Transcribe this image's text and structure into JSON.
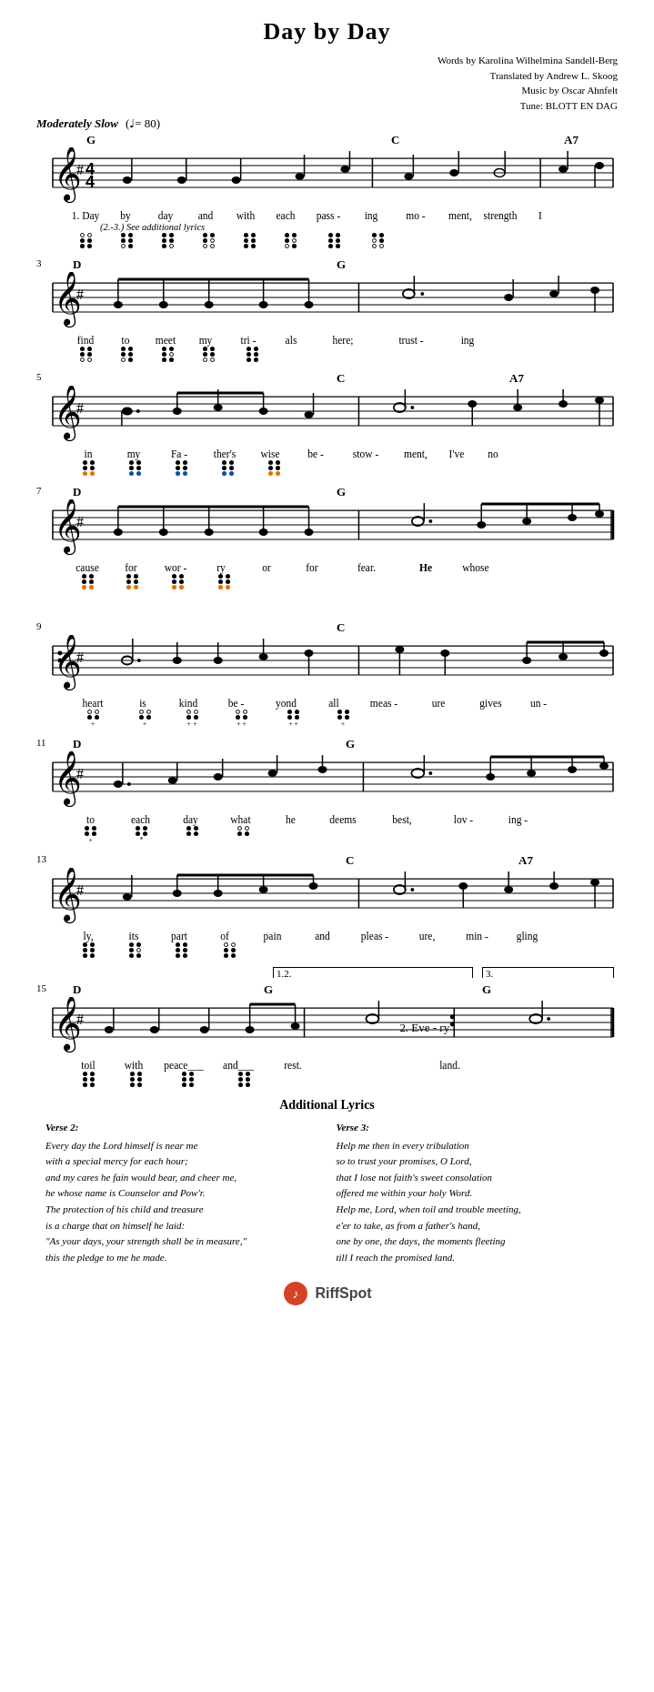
{
  "title": "Day by Day",
  "attribution": {
    "line1": "Words by Karolina Wilhelmina Sandell-Berg",
    "line2": "Translated by Andrew L. Skoog",
    "line3": "Music by Oscar Ahnfelt",
    "line4": "Tune: BLOTT EN DAG"
  },
  "tempo": {
    "label": "Moderately Slow",
    "bpm": "♩= 80"
  },
  "additional_lyrics": {
    "title": "Additional Lyrics",
    "verse2": {
      "title": "Verse 2:",
      "lines": [
        "Every day the Lord himself is near me",
        "with a special mercy for each hour;",
        "and my cares he fain would bear, and cheer me,",
        "he whose name is Counselor and Pow'r.",
        "The protection of his child and treasure",
        "is a charge that on himself he laid:",
        "\"As your days, your strength shall be in measure,\"",
        "this the pledge to me he made."
      ]
    },
    "verse3": {
      "title": "Verse 3:",
      "lines": [
        "Help me then in every tribulation",
        "so to trust your promises, O Lord,",
        "that I lose not faith's sweet consolation",
        "offered me within your holy Word.",
        "Help me, Lord, when toil and trouble meeting,",
        "e'er to take, as from a father's hand,",
        "one by one, the days, the moments fleeting",
        "till I reach the promised land."
      ]
    }
  },
  "footer": {
    "logo_text": "RiffSpot",
    "logo_symbol": "🎵"
  }
}
